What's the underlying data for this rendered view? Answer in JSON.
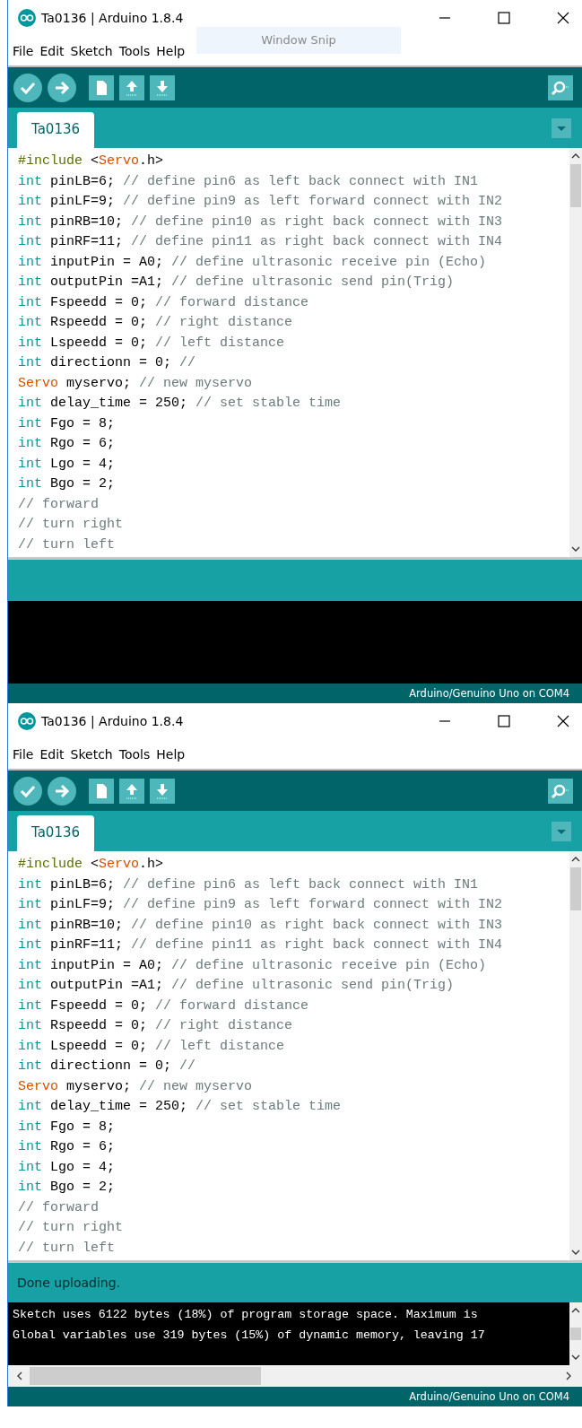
{
  "overlay_label": "Window Snip",
  "windows": [
    {
      "title": "Ta0136 | Arduino 1.8.4",
      "menu": [
        "File",
        "Edit",
        "Sketch",
        "Tools",
        "Help"
      ],
      "tabs": [
        {
          "label": "Ta0136",
          "selected": true
        }
      ],
      "code": [
        [
          {
            "kind": "dir",
            "text": "#include"
          },
          {
            "kind": "plain",
            "text": " <"
          },
          {
            "kind": "type",
            "text": "Servo"
          },
          {
            "kind": "plain",
            "text": ".h>"
          }
        ],
        [
          {
            "kind": "kw",
            "text": "int"
          },
          {
            "kind": "plain",
            "text": " pinLB=6; "
          },
          {
            "kind": "com",
            "text": "// define pin6 as left back connect with IN1"
          }
        ],
        [
          {
            "kind": "kw",
            "text": "int"
          },
          {
            "kind": "plain",
            "text": " pinLF=9; "
          },
          {
            "kind": "com",
            "text": "// define pin9 as left forward connect with IN2"
          }
        ],
        [
          {
            "kind": "kw",
            "text": "int"
          },
          {
            "kind": "plain",
            "text": " pinRB=10; "
          },
          {
            "kind": "com",
            "text": "// define pin10 as right back connect with IN3"
          }
        ],
        [
          {
            "kind": "kw",
            "text": "int"
          },
          {
            "kind": "plain",
            "text": " pinRF=11; "
          },
          {
            "kind": "com",
            "text": "// define pin11 as right back connect with IN4"
          }
        ],
        [
          {
            "kind": "kw",
            "text": "int"
          },
          {
            "kind": "plain",
            "text": " inputPin = A0; "
          },
          {
            "kind": "com",
            "text": "// define ultrasonic receive pin (Echo)"
          }
        ],
        [
          {
            "kind": "kw",
            "text": "int"
          },
          {
            "kind": "plain",
            "text": " outputPin =A1; "
          },
          {
            "kind": "com",
            "text": "// define ultrasonic send pin(Trig)"
          }
        ],
        [
          {
            "kind": "kw",
            "text": "int"
          },
          {
            "kind": "plain",
            "text": " Fspeedd = 0; "
          },
          {
            "kind": "com",
            "text": "// forward distance"
          }
        ],
        [
          {
            "kind": "kw",
            "text": "int"
          },
          {
            "kind": "plain",
            "text": " Rspeedd = 0; "
          },
          {
            "kind": "com",
            "text": "// right distance"
          }
        ],
        [
          {
            "kind": "kw",
            "text": "int"
          },
          {
            "kind": "plain",
            "text": " Lspeedd = 0; "
          },
          {
            "kind": "com",
            "text": "// left distance"
          }
        ],
        [
          {
            "kind": "kw",
            "text": "int"
          },
          {
            "kind": "plain",
            "text": " directionn = 0; "
          },
          {
            "kind": "com",
            "text": "//"
          }
        ],
        [
          {
            "kind": "type",
            "text": "Servo"
          },
          {
            "kind": "plain",
            "text": " myservo; "
          },
          {
            "kind": "com",
            "text": "// new myservo"
          }
        ],
        [
          {
            "kind": "kw",
            "text": "int"
          },
          {
            "kind": "plain",
            "text": " delay_time = 250; "
          },
          {
            "kind": "com",
            "text": "// set stable time"
          }
        ],
        [
          {
            "kind": "kw",
            "text": "int"
          },
          {
            "kind": "plain",
            "text": " Fgo = 8;"
          }
        ],
        [
          {
            "kind": "kw",
            "text": "int"
          },
          {
            "kind": "plain",
            "text": " Rgo = 6;"
          }
        ],
        [
          {
            "kind": "kw",
            "text": "int"
          },
          {
            "kind": "plain",
            "text": " Lgo = 4;"
          }
        ],
        [
          {
            "kind": "kw",
            "text": "int"
          },
          {
            "kind": "plain",
            "text": " Bgo = 2;"
          }
        ],
        [
          {
            "kind": "com",
            "text": "// forward"
          }
        ],
        [
          {
            "kind": "com",
            "text": "// turn right"
          }
        ],
        [
          {
            "kind": "com",
            "text": "// turn left"
          }
        ]
      ],
      "board": "Arduino/Genuino Uno on COM4"
    },
    {
      "title": "Ta0136 | Arduino 1.8.4",
      "menu": [
        "File",
        "Edit",
        "Sketch",
        "Tools",
        "Help"
      ],
      "tabs": [
        {
          "label": "Ta0136",
          "selected": true
        }
      ],
      "code": [
        [
          {
            "kind": "dir",
            "text": "#include"
          },
          {
            "kind": "plain",
            "text": " <"
          },
          {
            "kind": "type",
            "text": "Servo"
          },
          {
            "kind": "plain",
            "text": ".h>"
          }
        ],
        [
          {
            "kind": "kw",
            "text": "int"
          },
          {
            "kind": "plain",
            "text": " pinLB=6; "
          },
          {
            "kind": "com",
            "text": "// define pin6 as left back connect with IN1"
          }
        ],
        [
          {
            "kind": "kw",
            "text": "int"
          },
          {
            "kind": "plain",
            "text": " pinLF=9; "
          },
          {
            "kind": "com",
            "text": "// define pin9 as left forward connect with IN2"
          }
        ],
        [
          {
            "kind": "kw",
            "text": "int"
          },
          {
            "kind": "plain",
            "text": " pinRB=10; "
          },
          {
            "kind": "com",
            "text": "// define pin10 as right back connect with IN3"
          }
        ],
        [
          {
            "kind": "kw",
            "text": "int"
          },
          {
            "kind": "plain",
            "text": " pinRF=11; "
          },
          {
            "kind": "com",
            "text": "// define pin11 as right back connect with IN4"
          }
        ],
        [
          {
            "kind": "kw",
            "text": "int"
          },
          {
            "kind": "plain",
            "text": " inputPin = A0; "
          },
          {
            "kind": "com",
            "text": "// define ultrasonic receive pin (Echo)"
          }
        ],
        [
          {
            "kind": "kw",
            "text": "int"
          },
          {
            "kind": "plain",
            "text": " outputPin =A1; "
          },
          {
            "kind": "com",
            "text": "// define ultrasonic send pin(Trig)"
          }
        ],
        [
          {
            "kind": "kw",
            "text": "int"
          },
          {
            "kind": "plain",
            "text": " Fspeedd = 0; "
          },
          {
            "kind": "com",
            "text": "// forward distance"
          }
        ],
        [
          {
            "kind": "kw",
            "text": "int"
          },
          {
            "kind": "plain",
            "text": " Rspeedd = 0; "
          },
          {
            "kind": "com",
            "text": "// right distance"
          }
        ],
        [
          {
            "kind": "kw",
            "text": "int"
          },
          {
            "kind": "plain",
            "text": " Lspeedd = 0; "
          },
          {
            "kind": "com",
            "text": "// left distance"
          }
        ],
        [
          {
            "kind": "kw",
            "text": "int"
          },
          {
            "kind": "plain",
            "text": " directionn = 0; "
          },
          {
            "kind": "com",
            "text": "//"
          }
        ],
        [
          {
            "kind": "type",
            "text": "Servo"
          },
          {
            "kind": "plain",
            "text": " myservo; "
          },
          {
            "kind": "com",
            "text": "// new myservo"
          }
        ],
        [
          {
            "kind": "kw",
            "text": "int"
          },
          {
            "kind": "plain",
            "text": " delay_time = 250; "
          },
          {
            "kind": "com",
            "text": "// set stable time"
          }
        ],
        [
          {
            "kind": "kw",
            "text": "int"
          },
          {
            "kind": "plain",
            "text": " Fgo = 8;"
          }
        ],
        [
          {
            "kind": "kw",
            "text": "int"
          },
          {
            "kind": "plain",
            "text": " Rgo = 6;"
          }
        ],
        [
          {
            "kind": "kw",
            "text": "int"
          },
          {
            "kind": "plain",
            "text": " Lgo = 4;"
          }
        ],
        [
          {
            "kind": "kw",
            "text": "int"
          },
          {
            "kind": "plain",
            "text": " Bgo = 2;"
          }
        ],
        [
          {
            "kind": "com",
            "text": "// forward"
          }
        ],
        [
          {
            "kind": "com",
            "text": "// turn right"
          }
        ],
        [
          {
            "kind": "com",
            "text": "// turn left"
          }
        ]
      ],
      "status_message": "Done uploading.",
      "console_lines": [
        "Sketch uses 6122 bytes (18%) of program storage space. Maximum is",
        "Global variables use 319 bytes (15%) of dynamic memory, leaving 17"
      ],
      "board": "Arduino/Genuino Uno on COM4"
    }
  ]
}
